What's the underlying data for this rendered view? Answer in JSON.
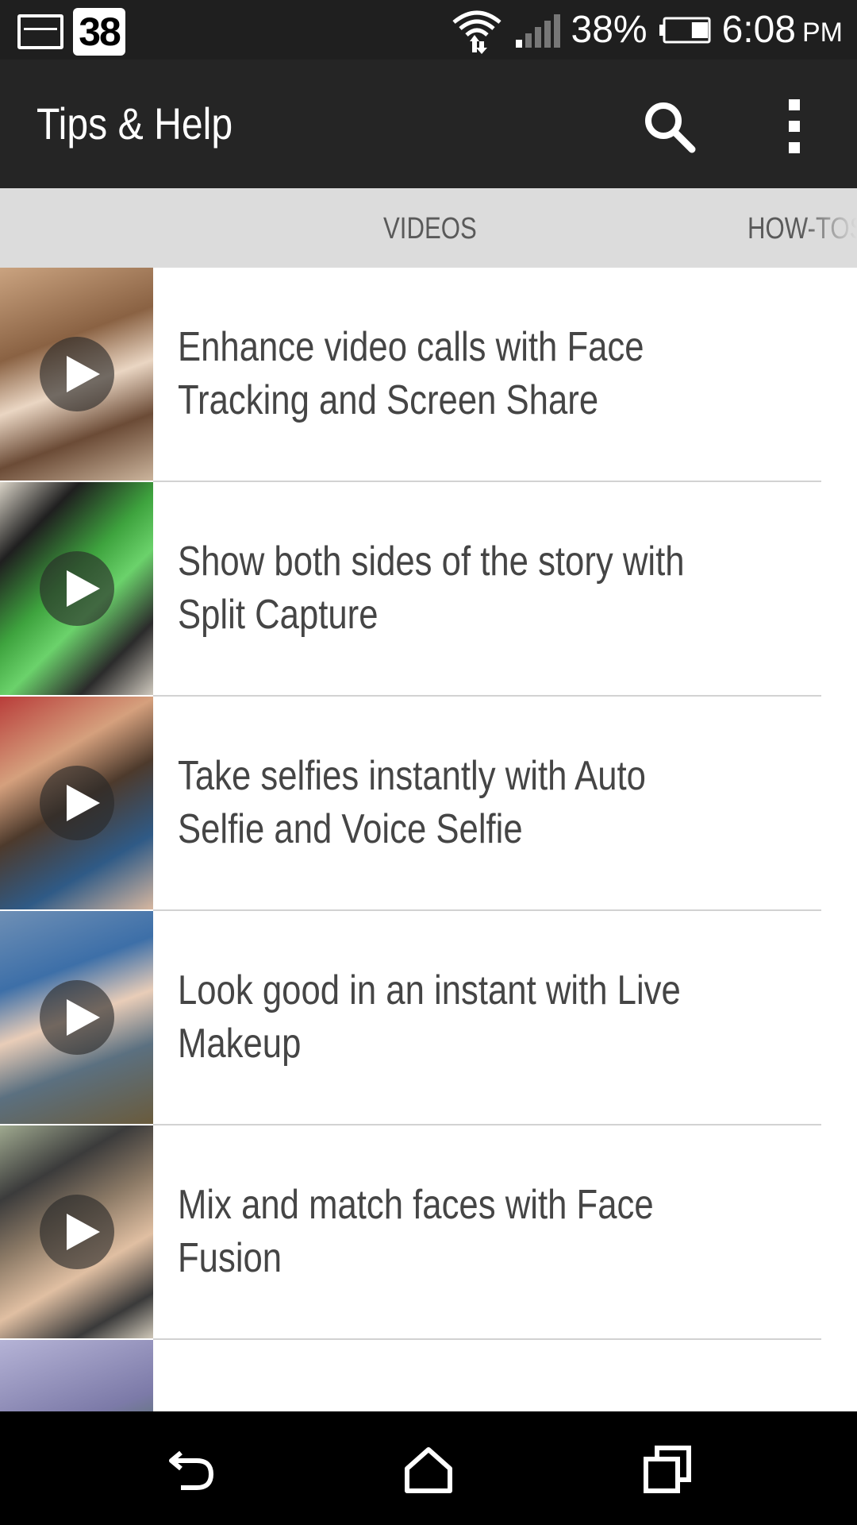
{
  "status_bar": {
    "notification_icons": [
      "image-icon",
      "calendar-icon"
    ],
    "calendar_day": "38",
    "battery_percent": "38%",
    "battery_level": 0.38,
    "time": "6:08",
    "ampm": "PM"
  },
  "action_bar": {
    "title": "Tips & Help",
    "icons": [
      "search-icon",
      "overflow-menu-icon"
    ]
  },
  "tabs": [
    {
      "label": "VIDEOS",
      "selected": true
    },
    {
      "label": "HOW-TOS",
      "selected": false
    }
  ],
  "videos": [
    {
      "title": "Enhance video calls with Face Tracking and Screen Share"
    },
    {
      "title": "Show both sides of the story with Split Capture"
    },
    {
      "title": "Take selfies instantly with Auto Selfie and Voice Selfie"
    },
    {
      "title": "Look good in an instant with Live Makeup"
    },
    {
      "title": "Mix and match faces with Face Fusion"
    },
    {
      "title": ""
    }
  ],
  "nav_bar": {
    "icons": [
      "back-icon",
      "home-icon",
      "recents-icon"
    ]
  },
  "colors": {
    "status_bar": "#1f1f1f",
    "action_bar": "#252525",
    "tab_bar": "#dcdcdc",
    "title_text": "#454545"
  }
}
